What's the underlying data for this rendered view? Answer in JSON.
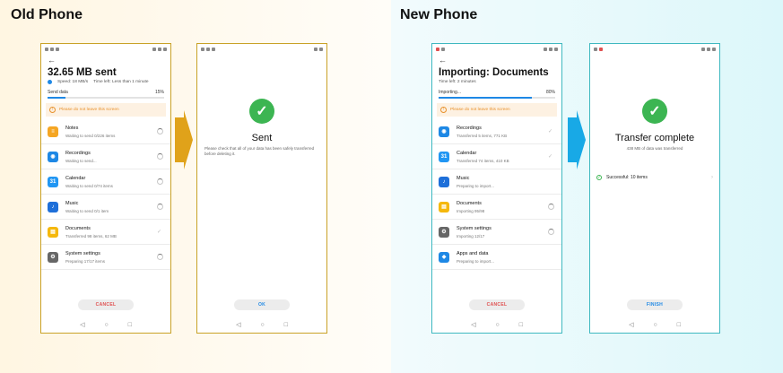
{
  "sections": {
    "old": "Old Phone",
    "new": "New Phone"
  },
  "colors": {
    "old_border": "#c9a227",
    "new_border": "#3fb8c0",
    "old_arrow": "#e0a21a",
    "new_arrow": "#18a9e6",
    "accent": "#1e88e5",
    "warning": "#e8912c",
    "success": "#3cb552",
    "cancel": "#e05050"
  },
  "common": {
    "warning": "Please do not leave this screen"
  },
  "old_send": {
    "title": "32.65 MB sent",
    "speed": "Speed: 18 MB/s",
    "time_left": "Time left: Less than 1 minute",
    "progress_label": "Send data",
    "progress_value": "15%",
    "progress_fraction": 0.15,
    "items": [
      {
        "name": "Notes",
        "status": "Waiting to send 0/226 items",
        "icon": "notes-icon",
        "color": "#f5a623",
        "state": "waiting"
      },
      {
        "name": "Recordings",
        "status": "Waiting to send...",
        "icon": "recordings-icon",
        "color": "#1e88e5",
        "state": "waiting"
      },
      {
        "name": "Calendar",
        "status": "Waiting to send 0/74 items",
        "icon": "calendar-icon",
        "color": "#2196f3",
        "state": "waiting"
      },
      {
        "name": "Music",
        "status": "Waiting to send 0/1 item",
        "icon": "music-icon",
        "color": "#1e6fd9",
        "state": "waiting"
      },
      {
        "name": "Documents",
        "status": "Transferred 98 items, 62 MB",
        "icon": "documents-icon",
        "color": "#f5b80c",
        "state": "done"
      },
      {
        "name": "System settings",
        "status": "Preparing 17/17 items",
        "icon": "settings-icon",
        "color": "#666666",
        "state": "waiting"
      }
    ],
    "button": "CANCEL"
  },
  "old_sent": {
    "title": "Sent",
    "message": "Please check that all of your data has been safely transferred before deleting it.",
    "button": "OK"
  },
  "new_import": {
    "title": "Importing: Documents",
    "time_left": "Time left: 2 minutes",
    "progress_label": "Importing...",
    "progress_value": "80%",
    "progress_fraction": 0.8,
    "items": [
      {
        "name": "Recordings",
        "status": "Transferred 5 items, 771 KB",
        "icon": "recordings-icon",
        "color": "#1e88e5",
        "state": "done"
      },
      {
        "name": "Calendar",
        "status": "Transferred 74 items, 410 KB",
        "icon": "calendar-icon",
        "color": "#2196f3",
        "state": "done"
      },
      {
        "name": "Music",
        "status": "Preparing to import...",
        "icon": "music-icon",
        "color": "#1e6fd9",
        "state": "none"
      },
      {
        "name": "Documents",
        "status": "Importing 95/98",
        "icon": "documents-icon",
        "color": "#f5b80c",
        "state": "waiting"
      },
      {
        "name": "System settings",
        "status": "Importing 12/17",
        "icon": "settings-icon",
        "color": "#666666",
        "state": "waiting"
      },
      {
        "name": "Apps and data",
        "status": "Preparing to import...",
        "icon": "apps-icon",
        "color": "#1e88e5",
        "state": "none"
      }
    ],
    "button": "CANCEL"
  },
  "new_complete": {
    "title": "Transfer complete",
    "message": "438 MB of data was transferred",
    "result": "Successful: 10 items",
    "button": "FINISH"
  }
}
